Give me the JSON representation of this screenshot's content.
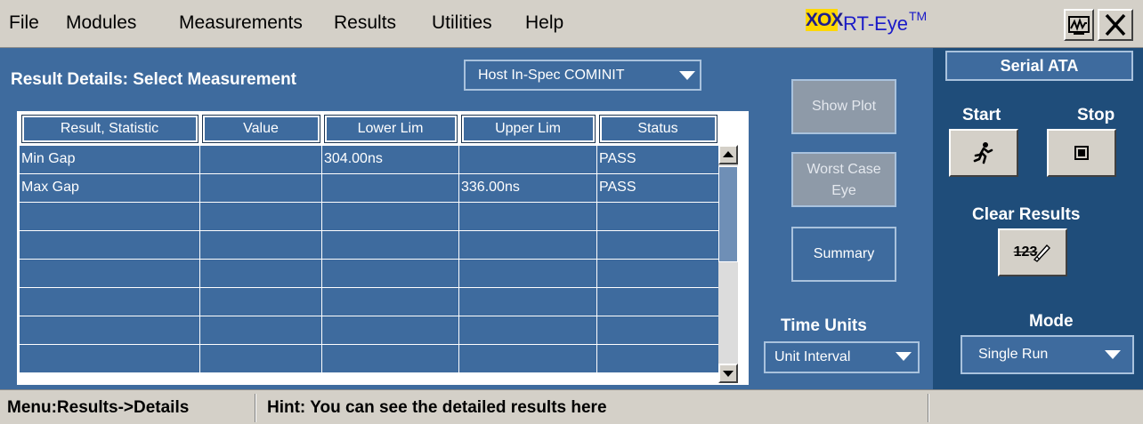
{
  "menu": [
    "File",
    "Modules",
    "Measurements",
    "Results",
    "Utilities",
    "Help"
  ],
  "brand": {
    "logo_text": "XOX",
    "name": "RT-Eye",
    "tm": "TM"
  },
  "panel": {
    "title": "Result Details: Select Measurement",
    "measurement_dropdown": "Host In-Spec COMINIT"
  },
  "table": {
    "columns": [
      "Result, Statistic",
      "Value",
      "Lower Lim",
      "Upper Lim",
      "Status"
    ],
    "rows": [
      [
        "Min Gap",
        "",
        "304.00ns",
        "",
        "PASS"
      ],
      [
        "Max Gap",
        "",
        "",
        "336.00ns",
        "PASS"
      ],
      [
        "",
        "",
        "",
        "",
        ""
      ],
      [
        "",
        "",
        "",
        "",
        ""
      ],
      [
        "",
        "",
        "",
        "",
        ""
      ],
      [
        "",
        "",
        "",
        "",
        ""
      ],
      [
        "",
        "",
        "",
        "",
        ""
      ],
      [
        "",
        "",
        "",
        "",
        ""
      ]
    ]
  },
  "actions": {
    "show_plot": "Show Plot",
    "worst_case_line1": "Worst Case",
    "worst_case_line2": "Eye",
    "summary": "Summary",
    "time_units_label": "Time Units",
    "time_units_value": "Unit Interval"
  },
  "right_panel": {
    "module": "Serial ATA",
    "start_label": "Start",
    "stop_label": "Stop",
    "clear_results_label": "Clear Results",
    "clear_icon_text": "123",
    "mode_label": "Mode",
    "mode_value": "Single Run"
  },
  "status_bar": {
    "menu_path": "Menu:Results->Details",
    "hint": "Hint: You can see the detailed results here"
  }
}
